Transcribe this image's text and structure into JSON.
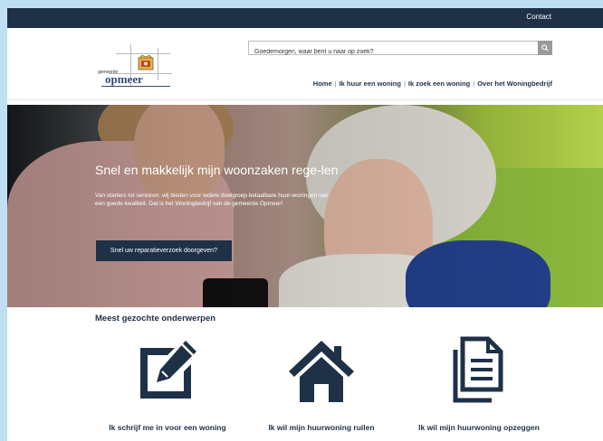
{
  "topbar": {
    "contact": "Contact"
  },
  "logo": {
    "small_text": "gemeente",
    "name": "opmeer"
  },
  "search": {
    "placeholder": "Goedemorgen, waar bent u naar op zoek?"
  },
  "nav": {
    "items": [
      "Home",
      "Ik huur een woning",
      "Ik zoek een woning",
      "Over het Woningbedrijf"
    ],
    "separator": "|"
  },
  "hero": {
    "title": "Snel en makkelijk mijn woonzaken rege-len",
    "text": "Van starters tot senioren: wij bieden voor iedere doelgroep betaalbare huur-woningen van een goede kwaliteit. Dat is het Woningbedrijf van de gemeente Opmeer!",
    "button": "Snel uw reparatieverzoek doorgeven?"
  },
  "topics": {
    "title": "Meest gezochte onderwerpen",
    "items": [
      {
        "label": "Ik schrijf me in voor een woning",
        "icon": "edit-icon"
      },
      {
        "label": "Ik wil mijn huurwoning ruilen",
        "icon": "home-icon"
      },
      {
        "label": "Ik wil mijn huurwoning opzeggen",
        "icon": "document-icon"
      }
    ]
  },
  "colors": {
    "primary": "#1e3147",
    "page_bg": "#bfe0f3"
  }
}
